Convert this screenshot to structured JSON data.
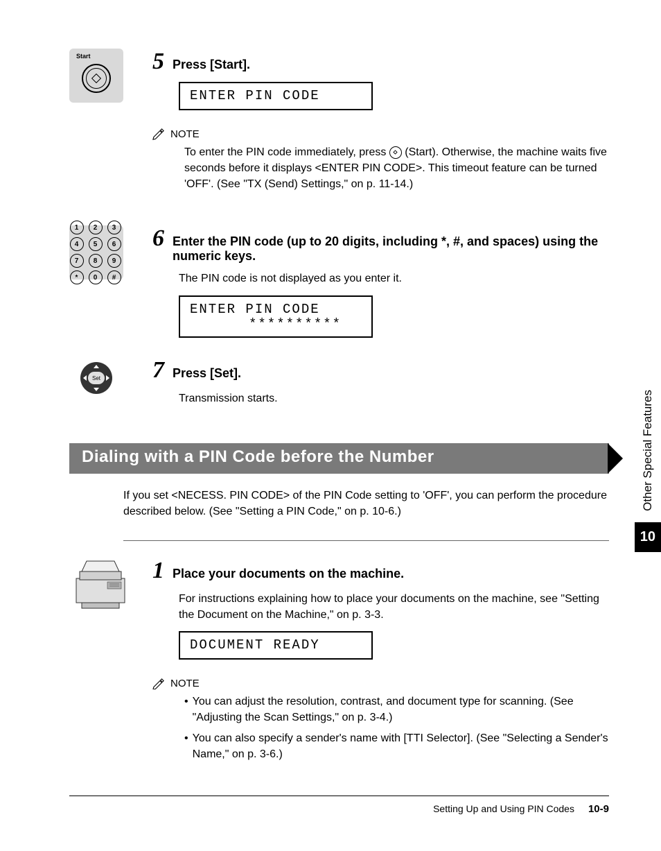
{
  "step5": {
    "number": "5",
    "icon_label": "Start",
    "title": "Press [Start].",
    "lcd": "ENTER PIN CODE",
    "note_label": "NOTE",
    "note_body_parts": {
      "p1": "To enter the PIN code immediately, press ",
      "p2": " (Start). Otherwise, the machine waits five seconds before it displays <ENTER PIN CODE>. This timeout feature can be turned 'OFF'. (See \"TX (Send) Settings,\" on p. 11-14.)"
    }
  },
  "step6": {
    "number": "6",
    "title": "Enter the PIN code (up to 20 digits, including *, #, and spaces) using the numeric keys.",
    "body": "The PIN code is not displayed as you enter it.",
    "lcd_line1": "ENTER PIN CODE",
    "lcd_line2": "**********",
    "keys": [
      "1",
      "2",
      "3",
      "4",
      "5",
      "6",
      "7",
      "8",
      "9",
      "*",
      "0",
      "#"
    ]
  },
  "step7": {
    "number": "7",
    "nav_label": "Set",
    "title": "Press [Set].",
    "body": "Transmission starts."
  },
  "section": {
    "heading": "Dialing with a PIN Code before the Number",
    "intro": "If you set <NECESS. PIN CODE> of the PIN Code setting to 'OFF', you can perform the procedure described below. (See \"Setting a PIN Code,\" on p. 10-6.)"
  },
  "step1": {
    "number": "1",
    "title": "Place your documents on the machine.",
    "body": "For instructions explaining how to place your documents on the machine, see \"Setting the Document on the Machine,\" on p. 3-3.",
    "lcd": "DOCUMENT READY",
    "note_label": "NOTE",
    "note_items": [
      "You can adjust the resolution, contrast, and document type for scanning. (See \"Adjusting the Scan Settings,\" on p. 3-4.)",
      "You can also specify a sender's name with [TTI Selector]. (See \"Selecting a Sender's Name,\" on p. 3-6.)"
    ]
  },
  "side": {
    "text": "Other Special Features",
    "chapter": "10"
  },
  "footer": {
    "title": "Setting Up and Using PIN Codes",
    "page": "10-9"
  }
}
